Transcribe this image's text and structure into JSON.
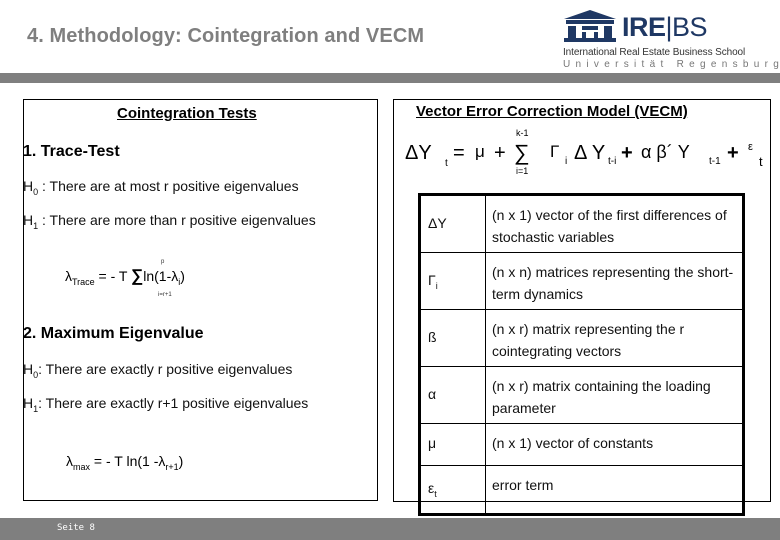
{
  "header": {
    "title": "4. Methodology: Cointegration and VECM",
    "logo": {
      "brand_left": "IRE",
      "brand_right": "BS",
      "line1": "International Real Estate Business School",
      "line2": "Universität Regensburg",
      "icon": "building-icon"
    }
  },
  "left": {
    "heading": "Cointegration Tests",
    "trace": {
      "title": "1. Trace-Test",
      "h0_label": "H",
      "h0_sub": "0",
      "h0_text": " : There are at most r positive eigenvalues",
      "h1_label": "H",
      "h1_sub": "1",
      "h1_text": " : There are more than r positive eigenvalues",
      "formula": {
        "lhs": "λ",
        "lhs_sub": "Trace",
        "eq": " = - T ",
        "sum": "∑",
        "upper": "p",
        "lower": "i=r+1",
        "body": "ln(1-λ",
        "body_sub": "i",
        "close": ")"
      }
    },
    "maxeig": {
      "title": "2. Maximum Eigenvalue",
      "h0_label": "H",
      "h0_sub": "0",
      "h0_text": ": There are exactly r positive eigenvalues",
      "h1_label": "H",
      "h1_sub": "1",
      "h1_text": ": There are exactly r+1 positive eigenvalues",
      "formula": {
        "lhs": "λ",
        "lhs_sub": "max",
        "eq": " = - T ln(1 -λ",
        "sub": "r+1",
        "close": ")"
      }
    }
  },
  "right": {
    "heading": "Vector Error Correction Model (VECM)",
    "equation": {
      "lhs": "ΔY",
      "lhs_sub": "t",
      "eq": "=",
      "mu": "μ",
      "plus1": "+",
      "sum": "∑",
      "sum_upper": "k-1",
      "sum_lower": "i=1",
      "gamma": "Γ",
      "gamma_sub": "i",
      "dy": "Δ Y",
      "dy_sub": "t-i",
      "plus2": "+",
      "ab": "α β´ Y",
      "ab_sub": "t-1",
      "plus3": "+",
      "eps": "ε",
      "eps_sub": "t"
    },
    "definitions": [
      {
        "symbol": "ΔY",
        "symbol_sub": "",
        "text": "(n x 1) vector of the first differences of stochastic variables"
      },
      {
        "symbol": "Γ",
        "symbol_sub": "i",
        "text": "(n x n) matrices representing the short-term dynamics"
      },
      {
        "symbol": "ß",
        "symbol_sub": "",
        "text": "(n x r) matrix representing the r cointegrating vectors"
      },
      {
        "symbol": "α",
        "symbol_sub": "",
        "text": "(n x r) matrix containing the loading parameter"
      },
      {
        "symbol": "μ",
        "symbol_sub": "",
        "text": "(n x 1) vector of constants"
      },
      {
        "symbol": "ε",
        "symbol_sub": "t",
        "text": "error term"
      }
    ]
  },
  "footer": {
    "page_label": "Seite 8"
  },
  "colors": {
    "bar_gray": "#7f7f7f",
    "title_gray": "#7f7f7f",
    "logo_navy": "#1f3864"
  }
}
